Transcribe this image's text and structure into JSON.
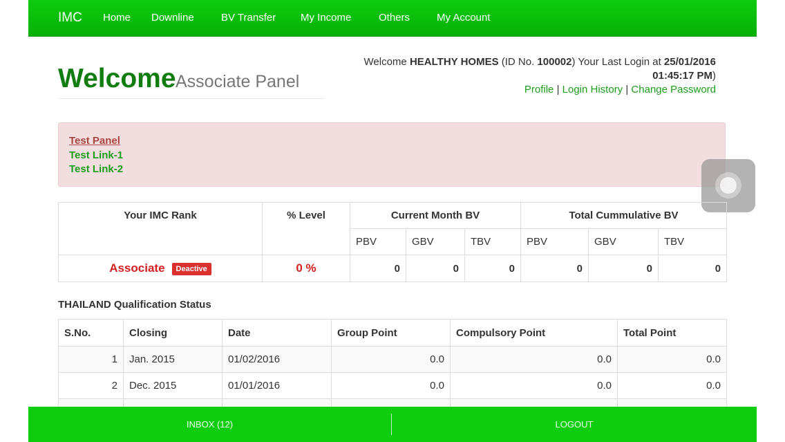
{
  "nav": {
    "brand": "IMC",
    "items": [
      "Home",
      "Downline",
      "BV Transfer",
      "My Income",
      "Others",
      "My Account"
    ]
  },
  "header": {
    "title": "Welcome",
    "subtitle": "Associate Panel",
    "welcome_prefix": "Welcome ",
    "user_name": "HEALTHY HOMES",
    "id_prefix": " (ID No. ",
    "user_id": "100002",
    "login_prefix": ") Your Last Login at ",
    "last_login_date": "25/01/2016",
    "last_login_time": "01:45:17 PM",
    "close_paren": ")",
    "links": [
      "Profile",
      "Login History",
      "Change Password"
    ],
    "separator": " | "
  },
  "panel": {
    "links": [
      "Test Panel",
      "Test Link-1",
      "Test Link-2"
    ]
  },
  "rank_table": {
    "headers": [
      "Your IMC Rank",
      "% Level",
      "Current Month BV",
      "Total Cummulative BV"
    ],
    "sub_headers": [
      "PBV",
      "GBV",
      "TBV",
      "PBV",
      "GBV",
      "TBV"
    ],
    "rank": "Associate",
    "status_badge": "Deactive",
    "level": "0 %",
    "values": [
      "0",
      "0",
      "0",
      "0",
      "0",
      "0"
    ]
  },
  "qualification": {
    "title": "THAILAND Qualification Status",
    "headers": [
      "S.No.",
      "Closing",
      "Date",
      "Group Point",
      "Compulsory Point",
      "Total Point"
    ],
    "rows": [
      [
        "1",
        "Jan. 2015",
        "01/02/2016",
        "0.0",
        "0.0",
        "0.0"
      ],
      [
        "2",
        "Dec. 2015",
        "01/01/2016",
        "0.0",
        "0.0",
        "0.0"
      ]
    ]
  },
  "bottom_bar": {
    "inbox": "INBOX (12)",
    "logout": "LOGOUT"
  },
  "colors": {
    "nav_green": "#0ecc0e",
    "title_green": "#117d11",
    "link_green": "#1c9e1c",
    "alert_bg": "#f2dede",
    "danger_red": "#d42020"
  }
}
